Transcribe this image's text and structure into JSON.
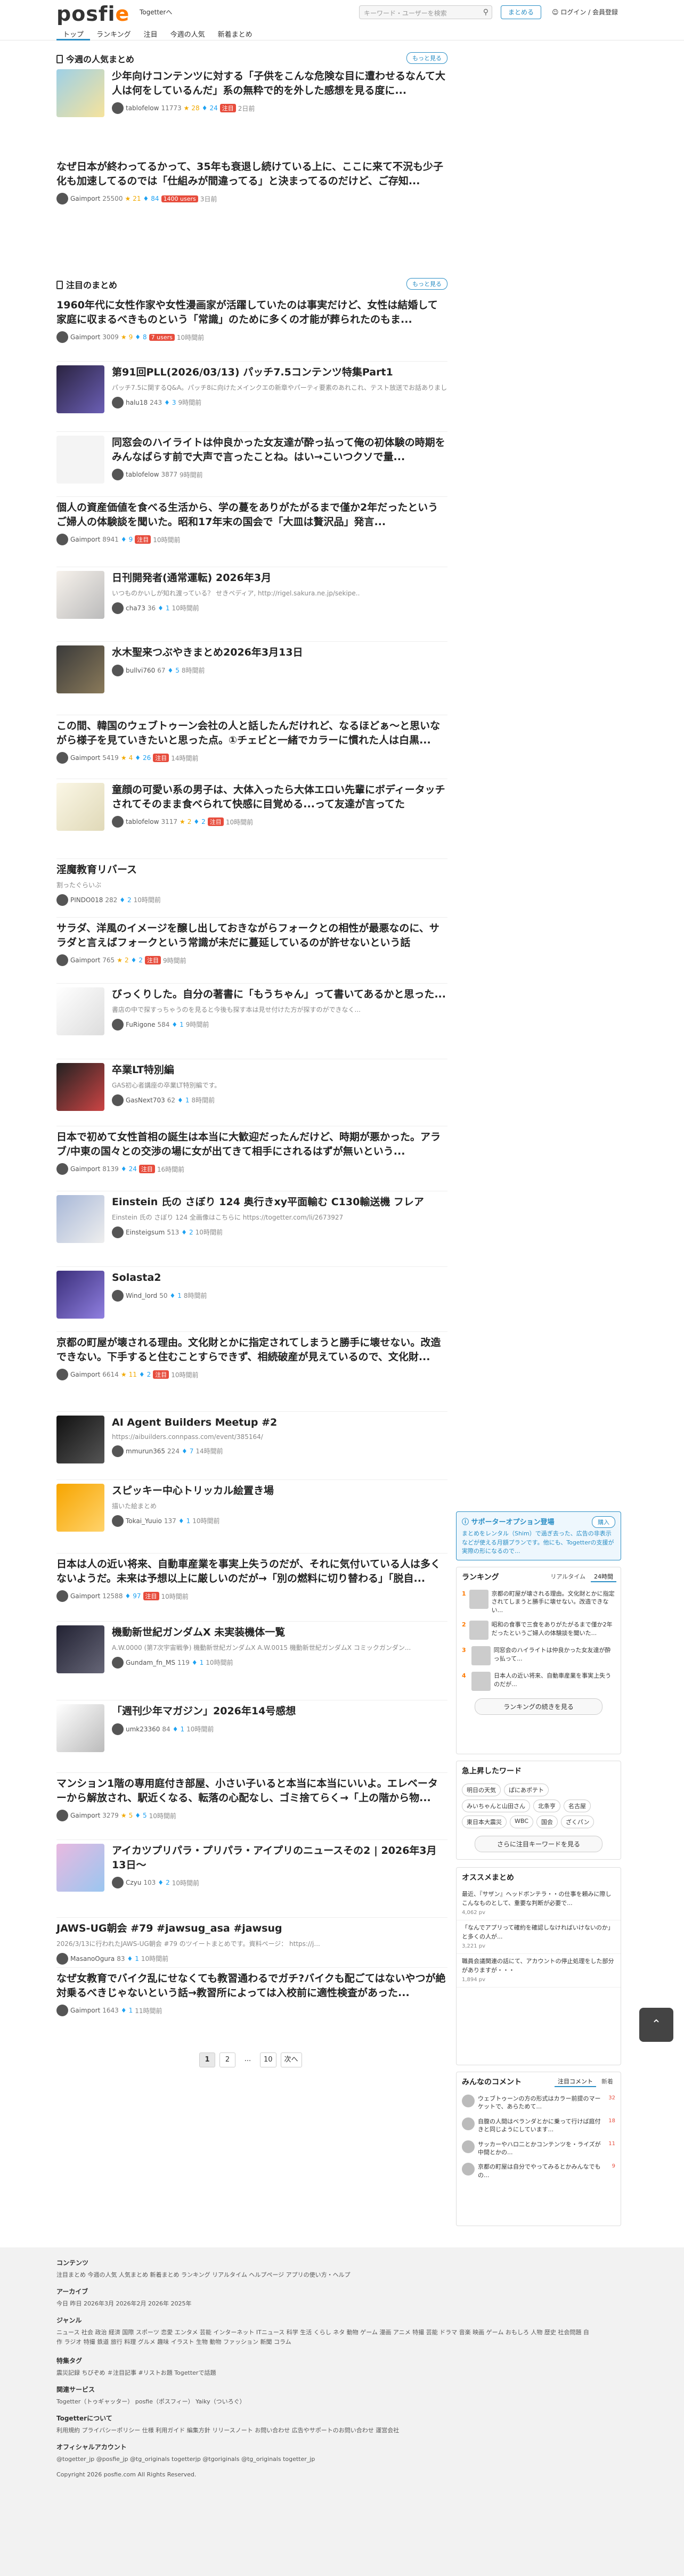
{
  "header": {
    "logo_main": "posfi",
    "logo_e": "e",
    "togetter_link": "Togetterへ",
    "search_placeholder": "キーワード・ユーザーを検索",
    "create_button": "まとめる",
    "login": "ログイン / 会員登録",
    "nav": [
      "トップ",
      "ランキング",
      "注目",
      "今週の人気",
      "新着まとめ"
    ]
  },
  "weekly": {
    "title": "今週の人気まとめ",
    "more": "もっと見る",
    "items": [
      {
        "title": "少年向けコンテンツに対する「子供をこんな危険な目に遭わせるなんて大人は何をしているんだ」系の無粋で的を外した感想を見る度に...",
        "user": "tablofelow",
        "count": "11773",
        "fav": "28",
        "tw": "24",
        "hot": "注目",
        "time": "2日前",
        "thumb": "c1"
      },
      {
        "title": "なぜ日本が終わってるかって、35年も衰退し続けている上に、ここに来て不況も少子化も加速してるのでは「仕組みが間違ってる」と決まってるのだけど、ご存知...",
        "user": "Gaimport",
        "count": "25500",
        "fav": "21",
        "tw": "84",
        "hot": "1400 users",
        "time": "3日前",
        "thumb": ""
      }
    ]
  },
  "featured": {
    "title": "注目のまとめ",
    "more": "もっと見る",
    "items": [
      {
        "title": "1960年代に女性作家や女性漫画家が活躍していたのは事実だけど、女性は結婚して家庭に収まるべきものという「常識」のために多くの才能が葬られたのもま...",
        "desc": "",
        "user": "Gaimport",
        "count": "3009",
        "fav": "9",
        "tw": "8",
        "hot": "7 users",
        "time": "10時間前",
        "thumb": ""
      },
      {
        "title": "第91回PLL(2026/03/13) パッチ7.5コンテンツ特集Part1",
        "desc": "パッチ7.5に関するQ&A。パッチ8に向けたメインクエの新章やパーティ要素のあれこれ、テスト放送でお話ありました。",
        "user": "halu18",
        "count": "243",
        "fav": "",
        "tw": "3",
        "hot": "",
        "time": "9時間前",
        "thumb": "c2"
      },
      {
        "title": "同窓会のハイライトは仲良かった女友達が酔っ払って俺の初体験の時期をみんなばらす前で大声で言ったことね。はい→こいつクソで量...",
        "desc": "",
        "user": "tablofelow",
        "count": "3877",
        "fav": "",
        "tw": "",
        "hot": "",
        "time": "9時間前",
        "thumb": "c3"
      },
      {
        "title": "個人の資産価値を食べる生活から、学の蔓をありがたがるまで僅か2年だったというご婦人の体験談を聞いた。昭和17年末の国会で「大皿は贅沢品」発言...",
        "desc": "",
        "user": "Gaimport",
        "count": "8941",
        "fav": "",
        "tw": "9",
        "hot": "注目",
        "time": "10時間前",
        "thumb": ""
      },
      {
        "title": "日刊開発者(通常運転) 2026年3月",
        "desc": "いつものかいしが知れ渡っている？ せきペディア, http://rigel.sakura.ne.jp/sekipe..",
        "user": "cha73",
        "count": "36",
        "fav": "",
        "tw": "1",
        "hot": "",
        "time": "10時間前",
        "thumb": "c4"
      },
      {
        "title": "水木聖来つぶやきまとめ2026年3月13日",
        "desc": "",
        "user": "bullvi760",
        "count": "67",
        "fav": "",
        "tw": "5",
        "hot": "",
        "time": "8時間前",
        "thumb": "c5"
      },
      {
        "title": "この間、韓国のウェブトゥーン会社の人と話したんだけれど、なるほどぁ～と思いながら様子を見ていきたいと思った点。①チェビと一緒でカラーに慣れた人は白黒...",
        "desc": "",
        "user": "Gaimport",
        "count": "5419",
        "fav": "4",
        "tw": "26",
        "hot": "注目",
        "time": "14時間前",
        "thumb": ""
      },
      {
        "title": "童顔の可愛い系の男子は、大体入ったら大体エロい先輩にボディータッチされてそのまま食べられて快感に目覚める...って友達が言ってた",
        "desc": "",
        "user": "tablofelow",
        "count": "3117",
        "fav": "2",
        "tw": "2",
        "hot": "注目",
        "time": "10時間前",
        "thumb": "c6"
      },
      {
        "title": "淫魔教育リバース",
        "desc": "割ったぐらいぶ",
        "user": "PINDO018",
        "count": "282",
        "fav": "",
        "tw": "2",
        "hot": "",
        "time": "10時間前",
        "thumb": ""
      },
      {
        "title": "サラダ、洋風のイメージを醸し出しておきながらフォークとの相性が最悪なのに、サラダと言えばフォークという常識が未だに蔓延しているのが許せないという話",
        "desc": "",
        "user": "Gaimport",
        "count": "765",
        "fav": "2",
        "tw": "2",
        "hot": "注目",
        "time": "9時間前",
        "thumb": ""
      },
      {
        "title": "びっくりした。自分の著書に「もうちゃん」って書いてあるかと思った...",
        "desc": "書店の中で探すっちゃうのを見ると今後も探す本は見せ付けた方が探すのができなく...",
        "user": "FuRigone",
        "count": "584",
        "fav": "",
        "tw": "1",
        "hot": "",
        "time": "9時間前",
        "thumb": "c7"
      },
      {
        "title": "卒業LT特別編",
        "desc": "GAS初心者講座の卒業LT特別編です。",
        "user": "GasNext703",
        "count": "62",
        "fav": "",
        "tw": "1",
        "hot": "",
        "time": "8時間前",
        "thumb": "c8"
      },
      {
        "title": "日本で初めて女性首相の誕生は本当に大歓迎だったんだけど、時期が悪かった。アラブ/中東の国々との交渉の場に女が出てきて相手にされるはずが無いという...",
        "desc": "",
        "user": "Gaimport",
        "count": "8139",
        "fav": "",
        "tw": "24",
        "hot": "注目",
        "time": "16時間前",
        "thumb": ""
      },
      {
        "title": "Einstein 氏の さぼり 124 奥行きxy平面輸む C130輸送機 フレア",
        "desc": "Einstein 氏の さぼり 124 全画像はこちらに https://togetter.com/li/2673927",
        "user": "Einsteigsum",
        "count": "513",
        "fav": "",
        "tw": "2",
        "hot": "",
        "time": "10時間前",
        "thumb": "c9"
      },
      {
        "title": "Solasta2",
        "desc": "",
        "user": "Wind_lord",
        "count": "50",
        "fav": "",
        "tw": "1",
        "hot": "",
        "time": "8時間前",
        "thumb": "c10"
      },
      {
        "title": "京都の町屋が壊される理由。文化財とかに指定されてしまうと勝手に壊せない。改造できない。下手すると住むことすらできず、相続破産が見えているので、文化財...",
        "desc": "",
        "user": "Gaimport",
        "count": "6614",
        "fav": "11",
        "tw": "2",
        "hot": "注目",
        "time": "10時間前",
        "thumb": ""
      },
      {
        "title": "AI Agent Builders Meetup #2",
        "desc": "https://aibuilders.connpass.com/event/385164/",
        "user": "mmurun365",
        "count": "224",
        "fav": "",
        "tw": "7",
        "hot": "",
        "time": "14時間前",
        "thumb": "c11"
      },
      {
        "title": "スピッキー中心トリッカル絵置き場",
        "desc": "描いた絵まとめ",
        "user": "Tokai_Yuuio",
        "count": "137",
        "fav": "",
        "tw": "1",
        "hot": "",
        "time": "10時間前",
        "thumb": "c12"
      },
      {
        "title": "日本は人の近い将来、自動車産業を事実上失うのだが、それに気付いている人は多くないようだ。未来は予想以上に厳しいのだが→「別の燃料に切り替わる」「脱自...",
        "desc": "",
        "user": "Gaimport",
        "count": "12588",
        "fav": "",
        "tw": "97",
        "hot": "注目",
        "time": "10時間前",
        "thumb": ""
      },
      {
        "title": "機動新世紀ガンダムX 未実装機体一覧",
        "desc": "A.W.0000 (第7次宇宙戦争) 機動新世紀ガンダムX A.W.0015 機動新世紀ガンダムX コミックガンダン...",
        "user": "Gundam_fn_MS",
        "count": "119",
        "fav": "",
        "tw": "1",
        "hot": "",
        "time": "10時間前",
        "thumb": "c13"
      },
      {
        "title": "「週刊少年マガジン」2026年14号感想",
        "desc": "",
        "user": "umk23360",
        "count": "84",
        "fav": "",
        "tw": "1",
        "hot": "",
        "time": "10時間前",
        "thumb": "c14"
      },
      {
        "title": "マンション1階の専用庭付き部屋、小さい子いると本当に本当にいいよ。エレベーターから解放され、駅近くなる、転落の心配なし、ゴミ捨てらく→「上の階から物...",
        "desc": "",
        "user": "Gaimport",
        "count": "3279",
        "fav": "5",
        "tw": "5",
        "hot": "",
        "time": "10時間前",
        "thumb": ""
      },
      {
        "title": "アイカツプリパラ・プリパラ・アイプリのニュースその2 | 2026年3月13日〜",
        "desc": "",
        "user": "Czyu",
        "count": "103",
        "fav": "",
        "tw": "2",
        "hot": "",
        "time": "10時間前",
        "thumb": "c15"
      },
      {
        "title": "JAWS-UG朝会 #79 #jawsug_asa #jawsug",
        "desc": "2026/3/13に行われたJAWS-UG朝会 #79 のツイートまとめです。資料ページ： https://j...",
        "user": "MasanoOgura",
        "count": "83",
        "fav": "",
        "tw": "1",
        "hot": "",
        "time": "10時間前",
        "thumb": ""
      },
      {
        "title": "なぜ女教育でバイク乱にせなくても教習通わるでガチ?バイクも配ごてはないやつが絶対乗るべきじゃないという話→教習所によっては入校前に適性検査があった...",
        "desc": "",
        "user": "Gaimport",
        "count": "1643",
        "fav": "",
        "tw": "1",
        "hot": "",
        "time": "11時間前",
        "thumb": ""
      }
    ]
  },
  "pager": [
    "1",
    "2",
    "...",
    "10",
    "次へ"
  ],
  "sidebar": {
    "support_title": "サポーターオプション登場",
    "support_button": "購入",
    "support_text": "まとめをレンタル（Shim）で過ぎ去った、広告の非表示などが使える月額プランです。他にも、Togetterの支援が実際の形になるので...",
    "ranking_title": "ランキング",
    "ranking_tabs": [
      "リアルタイム",
      "24時間"
    ],
    "ranking_items": [
      {
        "n": "1",
        "text": "京都の町屋が壊される理由。文化財とかに指定されてしまうと勝手に壊せない。改造できない..."
      },
      {
        "n": "2",
        "text": "昭和の食事で三食をありがたがるまで僅か2年だったというご婦人の体験談を聞いた..."
      },
      {
        "n": "3",
        "text": "同窓会のハイライトは仲良かった女友達が酔っ払って..."
      },
      {
        "n": "4",
        "text": "日本人の近い将来、自動車産業を事実上失うのだが..."
      }
    ],
    "ranking_more": "ランキングの続きを見る",
    "keywords_title": "急上昇したワード",
    "keywords": [
      "明日の天気",
      "ぱにあポテト",
      "みいちゃんと山田さん",
      "北条亨",
      "名古屋",
      "東日本大震災",
      "WBC",
      "国会",
      "ざくパン"
    ],
    "keywords_more": "さらに注目キーワードを見る",
    "recommend_title": "オススメまとめ",
    "recommend_items": [
      {
        "text": "最近、『サザン』ヘッドボンテラ・・の仕事を頼みに際しこんなものとして、重要な判断が必要で...",
        "meta": "4,062 pv"
      },
      {
        "text": "「なんでアプリって確約を確認しなければいけないのか」と多くの人が...",
        "meta": "3,221 pv"
      },
      {
        "text": "職員会議関連の話にて、アカウントの停止処理をした部分がありますが・・・",
        "meta": "1,894 pv"
      }
    ],
    "comments_title": "みんなのコメント",
    "comments_tabs": [
      "注目コメント",
      "新着"
    ],
    "comments": [
      {
        "text": "ウェブトゥーンの方の形式はカラー前提のマーケットで、あらためて...",
        "c": "32"
      },
      {
        "text": "自腹の人間はベランダとかに乗って行けば庭付きと同じようにしています...",
        "c": "18"
      },
      {
        "text": "サッカーやハロ二とかコンテンツを・ライズが中間とかの...",
        "c": "11"
      },
      {
        "text": "京都の町屋は自分でやってみるとかみんなでもの...",
        "c": "9"
      }
    ]
  },
  "footer": {
    "contents_title": "コンテンツ",
    "contents": "注目まとめ 今週の人気 人気まとめ 新着まとめ ランキング リアルタイム ヘルプページ アプリの使い方・ヘルプ",
    "archive_title": "アーカイブ",
    "archive": "今日 昨日 2026年3月 2026年2月 2026年 2025年",
    "genre_title": "ジャンル",
    "genre": "ニュース 社会 政治 経済 国際 スポーツ 恋愛 エンタメ 芸能 インターネット ITニュース 科学 生活 くらし ネタ 動物 ゲーム 漫画 アニメ 特撮 芸能 ドラマ 音楽 映画 ゲーム おもしろ 人物 歴史 社会問題 自作 ラジオ 特撮 鉄道 旅行 料理 グルメ 趣味 イラスト 生物 動物 ファッション 新聞 コラム",
    "tag_title": "特集タグ",
    "tag": "震災記録 ちびぞめ ＃注目記事 #リストお題 Togetterで話題",
    "related_title": "関連サービス",
    "related": "Togetter（トゥギャッター） posfie（ポスフィー） Yaiky（ついろぐ）",
    "togetter_title": "Togetterについて",
    "togetter": "利用規約 プライバシーポリシー 仕様 利用ガイド 編集方針 リリースノート お問い合わせ 広告やサポートのお問い合わせ 運営会社",
    "official_title": "オフィシャルアカウント",
    "official": "@togetter_jp  @posfie_jp  @tg_originals  togetterjp  @tgoriginals  @tg_originals  togetter_jp",
    "copyright": "Copyright 2026 posfie.com All Rights Reserved."
  }
}
